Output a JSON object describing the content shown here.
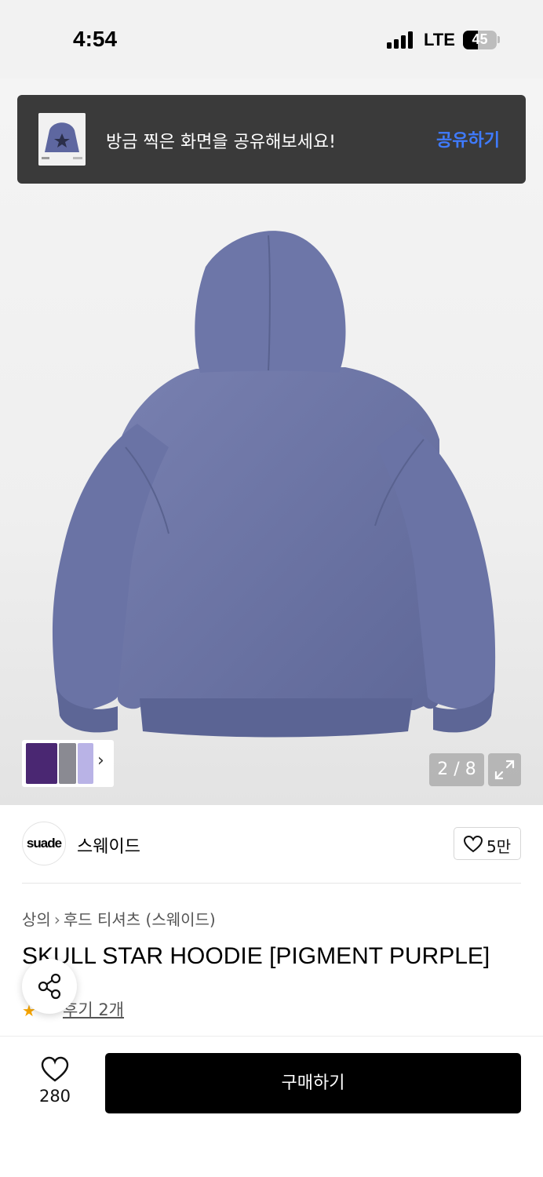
{
  "status_bar": {
    "time": "4:54",
    "network": "LTE",
    "battery": "45",
    "battery_level_percent": 45
  },
  "share_toast": {
    "message": "방금 찍은 화면을 공유해보세요!",
    "action": "공유하기"
  },
  "gallery": {
    "counter": "2 / 8",
    "hoodie_color": "#6e77a8"
  },
  "brand": {
    "logo_text": "suade",
    "name": "스웨이드",
    "like_count": "5만"
  },
  "product": {
    "breadcrumb": [
      "상의",
      "후드 티셔츠 (스웨이드)"
    ],
    "title": "SKULL STAR HOODIE [PIGMENT PURPLE]",
    "review_link": "후기 2개"
  },
  "bottom_bar": {
    "wish_count": "280",
    "buy_label": "구매하기"
  },
  "colors": {
    "accent": "#3f7bff",
    "buy_button": "#000000",
    "star": "#f6a500"
  }
}
